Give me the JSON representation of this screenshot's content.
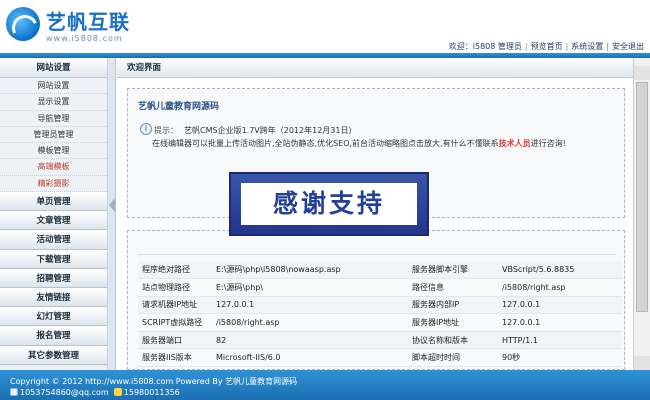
{
  "header": {
    "logo_title": "艺帆互联",
    "logo_url": "www.i5808.com",
    "welcome": "欢迎：",
    "user": "i5808 管理员",
    "links": [
      "预览首页",
      "系统设置",
      "安全退出"
    ]
  },
  "sidebar": {
    "head": "网站设置",
    "subitems": [
      {
        "label": "网站设置"
      },
      {
        "label": "显示设置"
      },
      {
        "label": "导航管理"
      },
      {
        "label": "管理员管理"
      },
      {
        "label": "模板管理"
      },
      {
        "label": "高端模板"
      },
      {
        "label": "精彩摄影"
      }
    ],
    "groups": [
      "单页管理",
      "文章管理",
      "活动管理",
      "下载管理",
      "招聘管理",
      "友情链接",
      "幻灯管理",
      "报名管理",
      "其它参数管理"
    ]
  },
  "main": {
    "head": "欢迎界面",
    "welcome_title": "艺帆儿童教育网源码",
    "tip_label": "提示：",
    "tip_line1": "艺帆CMS企业版1.7V跨年（2012年12月31日）",
    "tip_line2_pre": "在线编辑器可以批量上传活动图片,全站伪静态,优化SEO,前台活动缩略图点击放大,有什么不懂联系",
    "tip_line2_hl": "技术人员",
    "tip_line2_post": "进行咨询!",
    "thanks_text": "感谢支持",
    "info_rows": [
      {
        "k1": "程序绝对路径",
        "v1": "E:\\源码\\php\\i5808\\nowaasp.asp",
        "k2": "服务器脚本引擎",
        "v2": "VBScript/5.6.8835"
      },
      {
        "k1": "站点物理路径",
        "v1": "E:\\源码\\php\\",
        "k2": "路径信息",
        "v2": "/i5808/right.asp"
      },
      {
        "k1": "请求机器IP地址",
        "v1": "127.0.0.1",
        "k2": "服务器内部IP",
        "v2": "127.0.0.1"
      },
      {
        "k1": "SCRIPT虚拟路径",
        "v1": "/i5808/right.asp",
        "k2": "服务器IP地址",
        "v2": "127.0.0.1"
      },
      {
        "k1": "服务器端口",
        "v1": "82",
        "k2": "协议名称和版本",
        "v2": "HTTP/1.1"
      },
      {
        "k1": "服务器IIS版本",
        "v1": "Microsoft-IIS/6.0",
        "k2": "脚本超时时间",
        "v2": "90秒"
      }
    ]
  },
  "footer": {
    "line1": "Copyright © 2012 http://www.i5808.com Powered By 艺帆儿童教育网源码",
    "qq": "1053754860@qq.com",
    "phone": "15980011356"
  }
}
